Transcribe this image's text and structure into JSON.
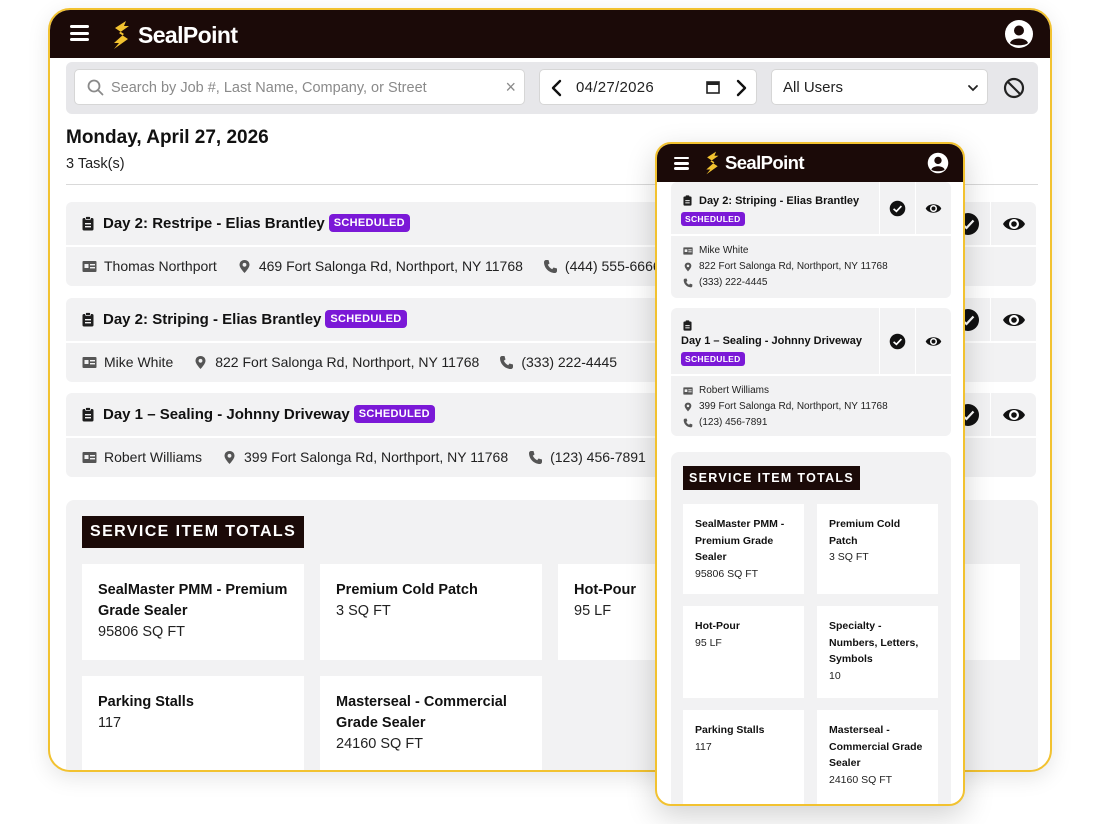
{
  "brand": {
    "name": "SealPoint"
  },
  "colors": {
    "header_bg": "#1b0a08",
    "accent": "#f2c230",
    "badge": "#7b19d7",
    "panel_bg": "#f2f2f3"
  },
  "toolbar": {
    "search_placeholder": "Search by Job #, Last Name, Company, or Street",
    "clear_label": "×",
    "date_value": "04/27/2026",
    "users_value": "All Users"
  },
  "schedule": {
    "title": "Monday, April 27, 2026",
    "count": "3 Task(s)"
  },
  "tasks": [
    {
      "title": "Day 2: Restripe - Elias Brantley",
      "status": "SCHEDULED",
      "contact": "Thomas Northport",
      "address": "469 Fort Salonga Rd, Northport, NY 11768",
      "phone": "(444) 555-6666"
    },
    {
      "title": "Day 2: Striping - Elias Brantley",
      "status": "SCHEDULED",
      "contact": "Mike White",
      "address": "822 Fort Salonga Rd, Northport, NY 11768",
      "phone": "(333) 222-4445"
    },
    {
      "title": "Day 1 – Sealing - Johnny Driveway",
      "status": "SCHEDULED",
      "contact": "Robert Williams",
      "address": "399 Fort Salonga Rd, Northport, NY 11768",
      "phone": "(123) 456-7891"
    }
  ],
  "totals": {
    "title": "SERVICE ITEM TOTALS",
    "items": [
      {
        "name": "SealMaster PMM - Premium Grade Sealer",
        "value": "95806 SQ FT"
      },
      {
        "name": "Premium Cold Patch",
        "value": "3 SQ FT"
      },
      {
        "name": "Hot-Pour",
        "value": "95 LF"
      },
      {
        "name": "Parking Stalls",
        "value": "117"
      },
      {
        "name": "Masterseal - Commercial Grade Sealer",
        "value": "24160 SQ FT"
      }
    ]
  },
  "mobile": {
    "tasks": [
      {
        "title": "Day 2: Striping - Elias Brantley",
        "status": "SCHEDULED",
        "contact": "Mike White",
        "address": "822 Fort Salonga Rd, Northport, NY 11768",
        "phone": "(333) 222-4445"
      },
      {
        "title": "Day 1 – Sealing - Johnny Driveway",
        "status": "SCHEDULED",
        "contact": "Robert Williams",
        "address": "399 Fort Salonga Rd, Northport, NY 11768",
        "phone": "(123) 456-7891"
      }
    ],
    "totals_title": "SERVICE ITEM TOTALS",
    "items": [
      {
        "name": "SealMaster PMM - Premium Grade Sealer",
        "value": "95806 SQ FT"
      },
      {
        "name": "Premium Cold Patch",
        "value": "3 SQ FT"
      },
      {
        "name": "Hot-Pour",
        "value": "95 LF"
      },
      {
        "name": "Specialty - Numbers, Letters, Symbols",
        "value": "10"
      },
      {
        "name": "Parking Stalls",
        "value": "117"
      },
      {
        "name": "Masterseal - Commercial Grade Sealer",
        "value": "24160 SQ FT"
      }
    ]
  }
}
